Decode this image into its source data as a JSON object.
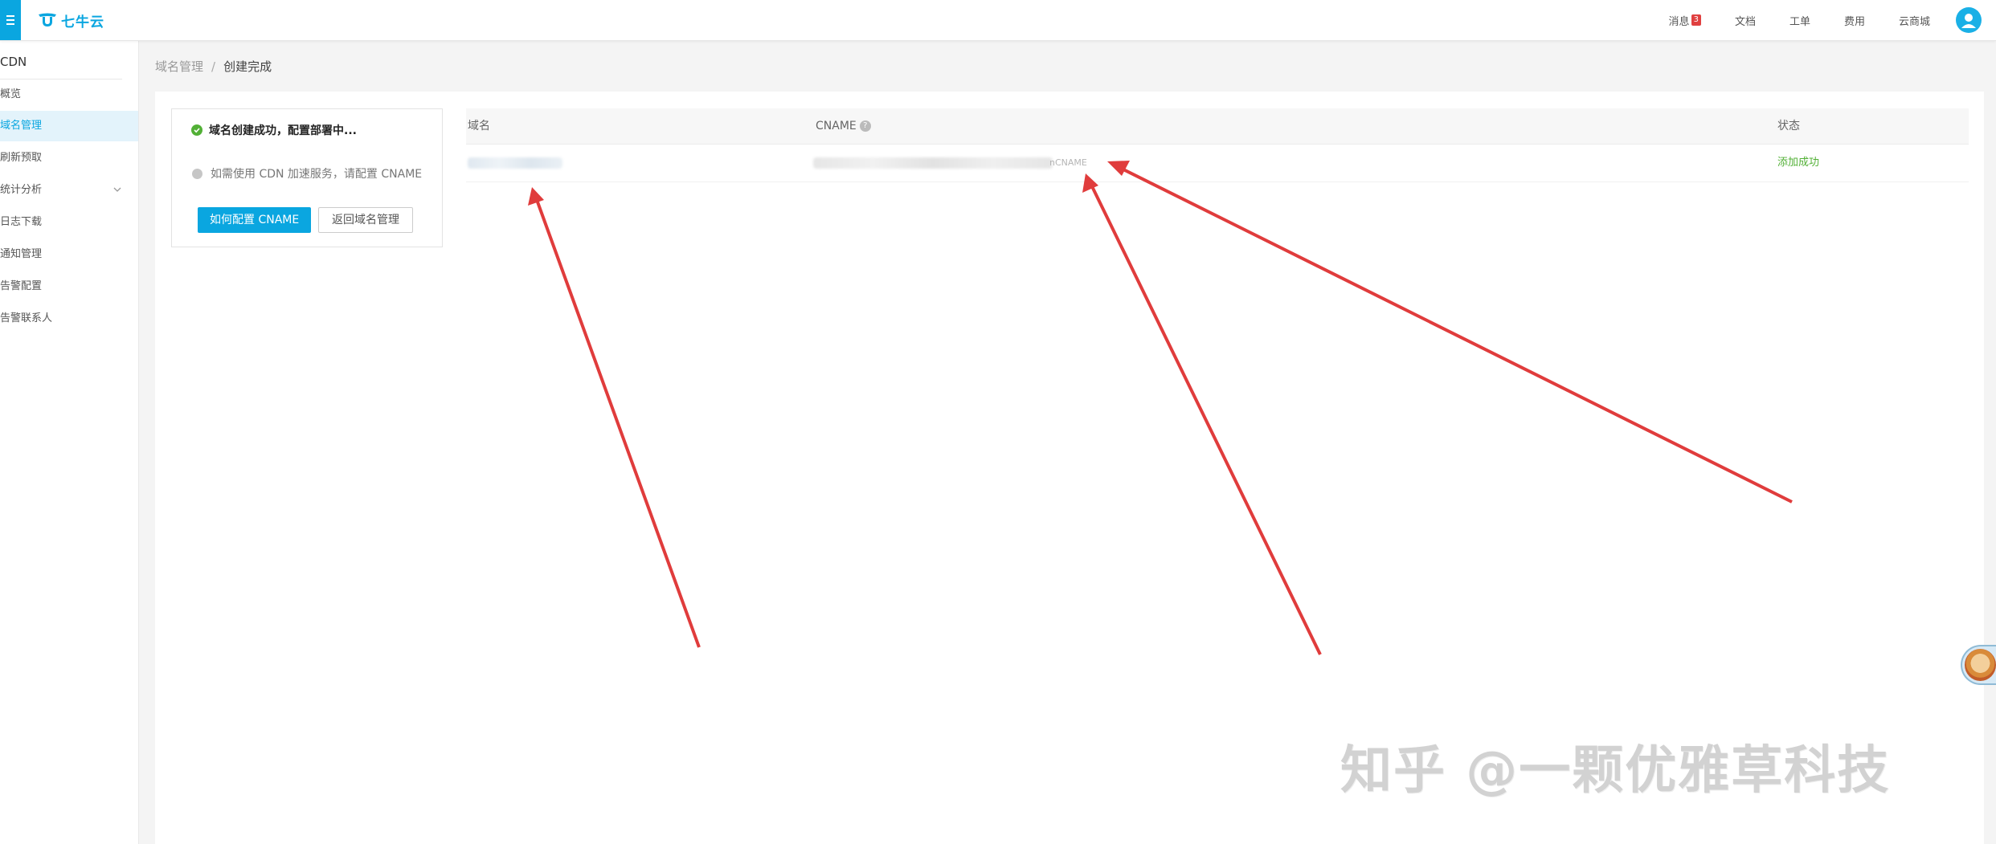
{
  "topbar": {
    "logo_text": "七牛云",
    "nav": [
      {
        "label": "消息",
        "badge": "3"
      },
      {
        "label": "文档"
      },
      {
        "label": "工单"
      },
      {
        "label": "费用"
      },
      {
        "label": "云商城"
      }
    ]
  },
  "sidebar": {
    "title": "CDN",
    "items": [
      {
        "label": "概览",
        "active": false
      },
      {
        "label": "域名管理",
        "active": true
      },
      {
        "label": "刷新预取",
        "active": false
      },
      {
        "label": "统计分析",
        "active": false,
        "expandable": true
      },
      {
        "label": "日志下载",
        "active": false
      },
      {
        "label": "通知管理",
        "active": false
      },
      {
        "label": "告警配置",
        "active": false
      },
      {
        "label": "告警联系人",
        "active": false
      }
    ]
  },
  "breadcrumb": {
    "parent": "域名管理",
    "separator": "/",
    "current": "创建完成"
  },
  "status_card": {
    "success_text": "域名创建成功，配置部署中...",
    "hint_text": "如需使用 CDN 加速服务，请配置 CNAME",
    "primary_button": "如何配置 CNAME",
    "secondary_button": "返回域名管理"
  },
  "table": {
    "columns": [
      "域名",
      "CNAME",
      "状态"
    ],
    "rows": [
      {
        "cname_suffix": "nCNAME",
        "status": "添加成功"
      }
    ]
  },
  "watermark": "知乎 @一颗优雅草科技",
  "colors": {
    "accent": "#0aa6e0",
    "success": "#52b036",
    "arrow": "#e03c3c"
  }
}
